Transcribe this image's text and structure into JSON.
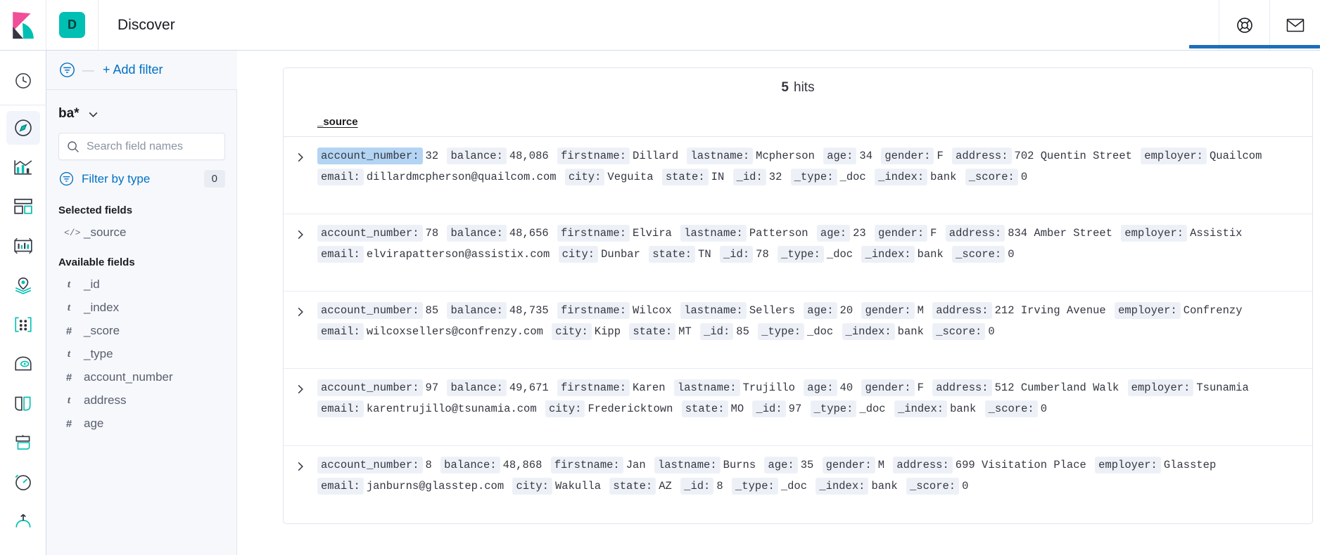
{
  "header": {
    "app_badge": "D",
    "title": "Discover",
    "icons": {
      "logo": "kibana-logo",
      "help": "help-lifebuoy-icon",
      "mail": "mail-envelope-icon"
    }
  },
  "nav_rail": {
    "items": [
      {
        "name": "recently-viewed",
        "icon": "clock-icon",
        "active": false
      },
      {
        "name": "discover",
        "icon": "compass-icon",
        "active": true
      },
      {
        "name": "visualize",
        "icon": "visualize-chart-icon",
        "active": false
      },
      {
        "name": "dashboard",
        "icon": "dashboard-grid-icon",
        "active": false
      },
      {
        "name": "canvas",
        "icon": "canvas-frame-icon",
        "active": false
      },
      {
        "name": "maps",
        "icon": "map-pin-layers-icon",
        "active": false
      },
      {
        "name": "machine-learning",
        "icon": "machine-learning-icon",
        "active": false
      },
      {
        "name": "graph",
        "icon": "graph-icon",
        "active": false
      },
      {
        "name": "uptime",
        "icon": "uptime-icon",
        "active": false
      },
      {
        "name": "apm",
        "icon": "apm-icon",
        "active": false
      },
      {
        "name": "metrics",
        "icon": "metrics-icon",
        "active": false
      },
      {
        "name": "logs",
        "icon": "logs-icon",
        "active": false
      }
    ]
  },
  "filter_bar": {
    "filter_icon": "filter-circle-icon",
    "dash": "—",
    "add_filter_label": "+ Add filter"
  },
  "sidebar": {
    "index_pattern": "ba*",
    "index_pattern_chevron": "chevron-down-icon",
    "search": {
      "placeholder": "Search field names",
      "value": "",
      "icon": "search-icon"
    },
    "filter_by_type": {
      "icon": "filter-circle-icon",
      "label": "Filter by type",
      "count": "0"
    },
    "selected_fields_title": "Selected fields",
    "selected_fields": [
      {
        "type_glyph": "</>",
        "type_kind": "code",
        "name": "_source"
      }
    ],
    "available_fields_title": "Available fields",
    "available_fields": [
      {
        "type_glyph": "t",
        "type_kind": "string",
        "name": "_id"
      },
      {
        "type_glyph": "t",
        "type_kind": "string",
        "name": "_index"
      },
      {
        "type_glyph": "#",
        "type_kind": "number",
        "name": "_score"
      },
      {
        "type_glyph": "t",
        "type_kind": "string",
        "name": "_type"
      },
      {
        "type_glyph": "#",
        "type_kind": "number",
        "name": "account_number"
      },
      {
        "type_glyph": "t",
        "type_kind": "string",
        "name": "address"
      },
      {
        "type_glyph": "#",
        "type_kind": "number",
        "name": "age"
      }
    ]
  },
  "collapse_handle": {
    "icon": "collapse-left-icon"
  },
  "results": {
    "hits_count": "5",
    "hits_label": "hits",
    "column_header": "_source",
    "expand_icon": "chevron-right-icon",
    "rows": [
      {
        "expand": ">",
        "fields": [
          {
            "key": "account_number:",
            "value": "32",
            "highlight": true
          },
          {
            "key": "balance:",
            "value": "48,086",
            "highlight": false
          },
          {
            "key": "firstname:",
            "value": "Dillard",
            "highlight": false
          },
          {
            "key": "lastname:",
            "value": "Mcpherson",
            "highlight": false
          },
          {
            "key": "age:",
            "value": "34",
            "highlight": false
          },
          {
            "key": "gender:",
            "value": "F",
            "highlight": false
          },
          {
            "key": "address:",
            "value": "702 Quentin Street",
            "highlight": false
          },
          {
            "key": "employer:",
            "value": "Quailcom",
            "highlight": false
          },
          {
            "key": "email:",
            "value": "dillardmcpherson@quailcom.com",
            "highlight": false
          },
          {
            "key": "city:",
            "value": "Veguita",
            "highlight": false
          },
          {
            "key": "state:",
            "value": "IN",
            "highlight": false
          },
          {
            "key": "_id:",
            "value": "32",
            "highlight": false
          },
          {
            "key": "_type:",
            "value": "_doc",
            "highlight": false
          },
          {
            "key": "_index:",
            "value": "bank",
            "highlight": false
          },
          {
            "key": "_score:",
            "value": "0",
            "highlight": false
          }
        ]
      },
      {
        "expand": ">",
        "fields": [
          {
            "key": "account_number:",
            "value": "78",
            "highlight": false
          },
          {
            "key": "balance:",
            "value": "48,656",
            "highlight": false
          },
          {
            "key": "firstname:",
            "value": "Elvira",
            "highlight": false
          },
          {
            "key": "lastname:",
            "value": "Patterson",
            "highlight": false
          },
          {
            "key": "age:",
            "value": "23",
            "highlight": false
          },
          {
            "key": "gender:",
            "value": "F",
            "highlight": false
          },
          {
            "key": "address:",
            "value": "834 Amber Street",
            "highlight": false
          },
          {
            "key": "employer:",
            "value": "Assistix",
            "highlight": false
          },
          {
            "key": "email:",
            "value": "elvirapatterson@assistix.com",
            "highlight": false
          },
          {
            "key": "city:",
            "value": "Dunbar",
            "highlight": false
          },
          {
            "key": "state:",
            "value": "TN",
            "highlight": false
          },
          {
            "key": "_id:",
            "value": "78",
            "highlight": false
          },
          {
            "key": "_type:",
            "value": "_doc",
            "highlight": false
          },
          {
            "key": "_index:",
            "value": "bank",
            "highlight": false
          },
          {
            "key": "_score:",
            "value": "0",
            "highlight": false
          }
        ]
      },
      {
        "expand": ">",
        "fields": [
          {
            "key": "account_number:",
            "value": "85",
            "highlight": false
          },
          {
            "key": "balance:",
            "value": "48,735",
            "highlight": false
          },
          {
            "key": "firstname:",
            "value": "Wilcox",
            "highlight": false
          },
          {
            "key": "lastname:",
            "value": "Sellers",
            "highlight": false
          },
          {
            "key": "age:",
            "value": "20",
            "highlight": false
          },
          {
            "key": "gender:",
            "value": "M",
            "highlight": false
          },
          {
            "key": "address:",
            "value": "212 Irving Avenue",
            "highlight": false
          },
          {
            "key": "employer:",
            "value": "Confrenzy",
            "highlight": false
          },
          {
            "key": "email:",
            "value": "wilcoxsellers@confrenzy.com",
            "highlight": false
          },
          {
            "key": "city:",
            "value": "Kipp",
            "highlight": false
          },
          {
            "key": "state:",
            "value": "MT",
            "highlight": false
          },
          {
            "key": "_id:",
            "value": "85",
            "highlight": false
          },
          {
            "key": "_type:",
            "value": "_doc",
            "highlight": false
          },
          {
            "key": "_index:",
            "value": "bank",
            "highlight": false
          },
          {
            "key": "_score:",
            "value": "0",
            "highlight": false
          }
        ]
      },
      {
        "expand": ">",
        "fields": [
          {
            "key": "account_number:",
            "value": "97",
            "highlight": false
          },
          {
            "key": "balance:",
            "value": "49,671",
            "highlight": false
          },
          {
            "key": "firstname:",
            "value": "Karen",
            "highlight": false
          },
          {
            "key": "lastname:",
            "value": "Trujillo",
            "highlight": false
          },
          {
            "key": "age:",
            "value": "40",
            "highlight": false
          },
          {
            "key": "gender:",
            "value": "F",
            "highlight": false
          },
          {
            "key": "address:",
            "value": "512 Cumberland Walk",
            "highlight": false
          },
          {
            "key": "employer:",
            "value": "Tsunamia",
            "highlight": false
          },
          {
            "key": "email:",
            "value": "karentrujillo@tsunamia.com",
            "highlight": false
          },
          {
            "key": "city:",
            "value": "Fredericktown",
            "highlight": false
          },
          {
            "key": "state:",
            "value": "MO",
            "highlight": false
          },
          {
            "key": "_id:",
            "value": "97",
            "highlight": false
          },
          {
            "key": "_type:",
            "value": "_doc",
            "highlight": false
          },
          {
            "key": "_index:",
            "value": "bank",
            "highlight": false
          },
          {
            "key": "_score:",
            "value": "0",
            "highlight": false
          }
        ]
      },
      {
        "expand": ">",
        "fields": [
          {
            "key": "account_number:",
            "value": "8",
            "highlight": false
          },
          {
            "key": "balance:",
            "value": "48,868",
            "highlight": false
          },
          {
            "key": "firstname:",
            "value": "Jan",
            "highlight": false
          },
          {
            "key": "lastname:",
            "value": "Burns",
            "highlight": false
          },
          {
            "key": "age:",
            "value": "35",
            "highlight": false
          },
          {
            "key": "gender:",
            "value": "M",
            "highlight": false
          },
          {
            "key": "address:",
            "value": "699 Visitation Place",
            "highlight": false
          },
          {
            "key": "employer:",
            "value": "Glasstep",
            "highlight": false
          },
          {
            "key": "email:",
            "value": "janburns@glasstep.com",
            "highlight": false
          },
          {
            "key": "city:",
            "value": "Wakulla",
            "highlight": false
          },
          {
            "key": "state:",
            "value": "AZ",
            "highlight": false
          },
          {
            "key": "_id:",
            "value": "8",
            "highlight": false
          },
          {
            "key": "_type:",
            "value": "_doc",
            "highlight": false
          },
          {
            "key": "_index:",
            "value": "bank",
            "highlight": false
          },
          {
            "key": "_score:",
            "value": "0",
            "highlight": false
          }
        ]
      }
    ]
  },
  "colors": {
    "accent_blue": "#0071c2",
    "progress_blue": "#1c6fba",
    "badge_teal": "#00bfb3",
    "logo_pink": "#f04e98",
    "logo_teal": "#00bfb3",
    "key_chip_bg": "#edf1f7",
    "key_chip_highlight_bg": "#b4d4f3",
    "sidebar_bg": "#f7f8fc"
  }
}
